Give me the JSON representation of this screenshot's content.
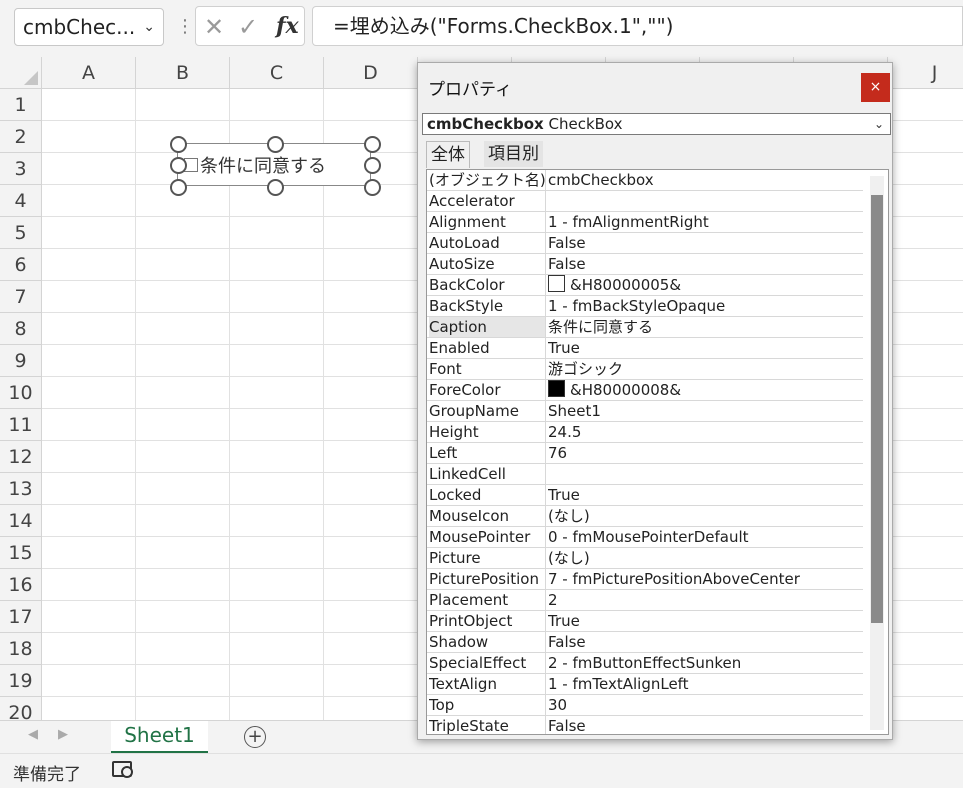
{
  "formula_bar": {
    "name_box": "cmbChec...",
    "formula": "=埋め込み(\"Forms.CheckBox.1\",\"\")",
    "cancel_icon": "✕",
    "enter_icon": "✓",
    "fx_label": "fx"
  },
  "columns": [
    "A",
    "B",
    "C",
    "D",
    "J"
  ],
  "rows": [
    "1",
    "2",
    "3",
    "4",
    "5",
    "6",
    "7",
    "8",
    "9",
    "10",
    "11",
    "12",
    "13",
    "14",
    "15",
    "16",
    "17",
    "18",
    "19",
    "20"
  ],
  "checkbox_control": {
    "label": "条件に同意する"
  },
  "sheet_tabs": {
    "active": "Sheet1",
    "add_icon": "+"
  },
  "status_bar": {
    "text": "準備完了"
  },
  "properties_window": {
    "title": "プロパティ",
    "close_icon": "×",
    "object_name": "cmbCheckbox",
    "object_type": "CheckBox",
    "tabs": [
      "全体",
      "項目別"
    ],
    "selected_property": "Caption",
    "properties": [
      {
        "name": "(オブジェクト名)",
        "value": "cmbCheckbox"
      },
      {
        "name": "Accelerator",
        "value": ""
      },
      {
        "name": "Alignment",
        "value": "1 - fmAlignmentRight"
      },
      {
        "name": "AutoLoad",
        "value": "False"
      },
      {
        "name": "AutoSize",
        "value": "False"
      },
      {
        "name": "BackColor",
        "value": "&H80000005&",
        "swatch": "#ffffff"
      },
      {
        "name": "BackStyle",
        "value": "1 - fmBackStyleOpaque"
      },
      {
        "name": "Caption",
        "value": "条件に同意する"
      },
      {
        "name": "Enabled",
        "value": "True"
      },
      {
        "name": "Font",
        "value": "游ゴシック"
      },
      {
        "name": "ForeColor",
        "value": "&H80000008&",
        "swatch": "#000000"
      },
      {
        "name": "GroupName",
        "value": "Sheet1"
      },
      {
        "name": "Height",
        "value": "24.5"
      },
      {
        "name": "Left",
        "value": "76"
      },
      {
        "name": "LinkedCell",
        "value": ""
      },
      {
        "name": "Locked",
        "value": "True"
      },
      {
        "name": "MouseIcon",
        "value": "(なし)"
      },
      {
        "name": "MousePointer",
        "value": "0 - fmMousePointerDefault"
      },
      {
        "name": "Picture",
        "value": "(なし)"
      },
      {
        "name": "PicturePosition",
        "value": "7 - fmPicturePositionAboveCenter"
      },
      {
        "name": "Placement",
        "value": "2"
      },
      {
        "name": "PrintObject",
        "value": "True"
      },
      {
        "name": "Shadow",
        "value": "False"
      },
      {
        "name": "SpecialEffect",
        "value": "2 - fmButtonEffectSunken"
      },
      {
        "name": "TextAlign",
        "value": "1 - fmTextAlignLeft"
      },
      {
        "name": "Top",
        "value": "30"
      },
      {
        "name": "TripleState",
        "value": "False"
      }
    ]
  }
}
